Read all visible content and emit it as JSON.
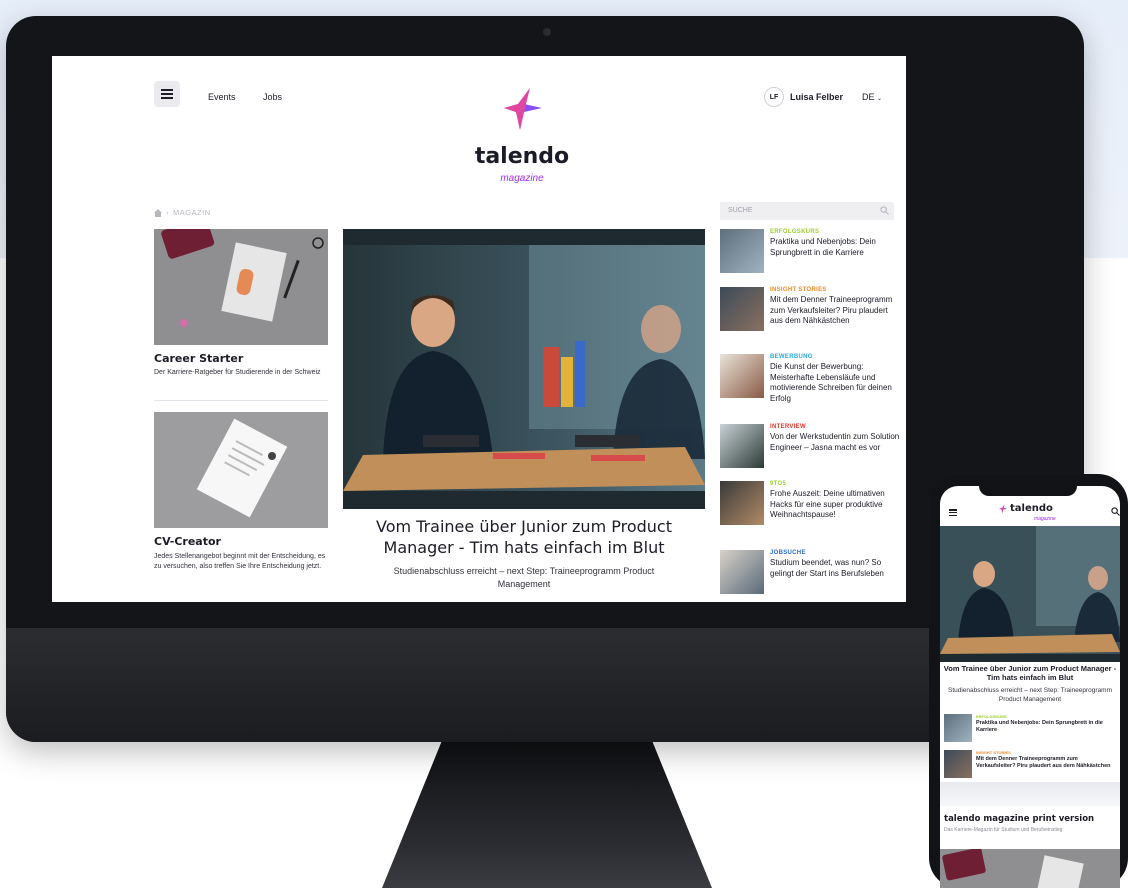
{
  "header": {
    "nav": [
      "Events",
      "Jobs"
    ],
    "user_initials": "LF",
    "user_name": "Luisa Felber",
    "language": "DE"
  },
  "logo": {
    "word": "talendo",
    "sub": "magazine"
  },
  "breadcrumb": {
    "current": "MAGAZIN"
  },
  "search": {
    "placeholder": "SUCHE"
  },
  "left_cards": [
    {
      "title": "Career Starter",
      "desc": "Der Karriere-Ratgeber für Studierende in der Schweiz"
    },
    {
      "title": "CV-Creator",
      "desc": "Jedes Stellenangebot beginnt mit der Entscheidung, es zu versuchen, also treffen Sie Ihre Entscheidung jetzt."
    }
  ],
  "hero": {
    "title": "Vom Trainee über Junior zum Product Manager - Tim hats einfach im Blut",
    "subtitle": "Studienabschluss erreicht – next Step: Traineeprogramm Product Management"
  },
  "side_articles": [
    {
      "category": "ERFOLGSKURS",
      "title": "Praktika und Nebenjobs: Dein Sprungbrett in die Karriere",
      "color": "#9ccf2c"
    },
    {
      "category": "INSIGHT STORIES",
      "title": "Mit dem Denner Traineeprogramm zum Verkaufsleiter? Piru plaudert aus dem Nähkästchen",
      "color": "#f08a24"
    },
    {
      "category": "BEWERBUNG",
      "title": "Die Kunst der Bewerbung: Meisterhafte Lebensläufe und motivierende Schreiben für deinen Erfolg",
      "color": "#2aa8d8"
    },
    {
      "category": "INTERVIEW",
      "title": "Von der Werkstudentin zum Solution Engineer – Jasna macht es vor",
      "color": "#e8352c"
    },
    {
      "category": "9TO5",
      "title": "Frohe Auszeit: Deine ultimativen Hacks für eine super produktive Weihnachtspause!",
      "color": "#9ccf2c"
    },
    {
      "category": "JOBSUCHE",
      "title": "Studium beendet, was nun? So gelingt der Start ins Berufsleben",
      "color": "#2a6ad8"
    }
  ],
  "phone": {
    "logo": "talendo",
    "logo_sub": "magazine",
    "hero_title": "Vom Trainee über Junior zum Product Manager - Tim hats einfach im Blut",
    "hero_subtitle": "Studienabschluss erreicht – next Step: Traineeprogramm Product Management",
    "items": [
      {
        "category": "ERFOLGSKURS",
        "title": "Praktika und Nebenjobs: Dein Sprungbrett in die Karriere"
      },
      {
        "category": "INSIGHT STORIES",
        "title": "Mit dem Denner Traineeprogramm zum Verkaufsleiter? Piru plaudert aus dem Nähkästchen"
      }
    ],
    "print_title": "talendo magazine print version",
    "print_desc": "Das Karriere-Magazin für Studium und Berufseinstieg"
  },
  "colors": {
    "accent": "#a42ef0",
    "star_pink": "#e0479e",
    "star_purple": "#7a3cf0"
  },
  "icons": [
    "menu-icon",
    "star-logo-icon",
    "home-icon",
    "search-icon",
    "chevron-down-icon"
  ]
}
